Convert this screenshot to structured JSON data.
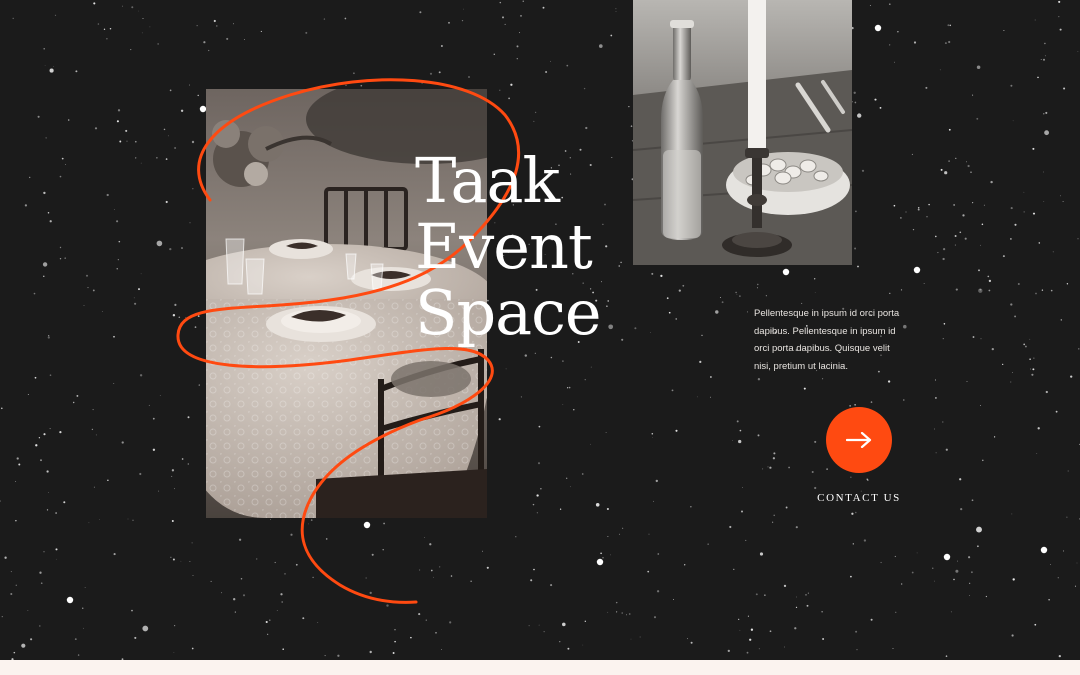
{
  "hero": {
    "title_line1": "Taak",
    "title_line2": "Event",
    "title_line3": "Space"
  },
  "blurb": {
    "text": "Pellentesque in ipsum id orci porta dapibus. Pellentesque in ipsum id orci porta dapibus. Quisque velit nisi, pretium ut lacinia."
  },
  "cta": {
    "label": "CONTACT US",
    "icon": "arrow-right-icon"
  },
  "colors": {
    "background": "#1b1b1b",
    "accent": "#ff4a11",
    "text": "#ffffff",
    "bottom_strip": "#fbf3ef"
  },
  "images": {
    "table_photo": "banquet-table-photo",
    "bottle_photo": "bottle-candle-photo"
  }
}
